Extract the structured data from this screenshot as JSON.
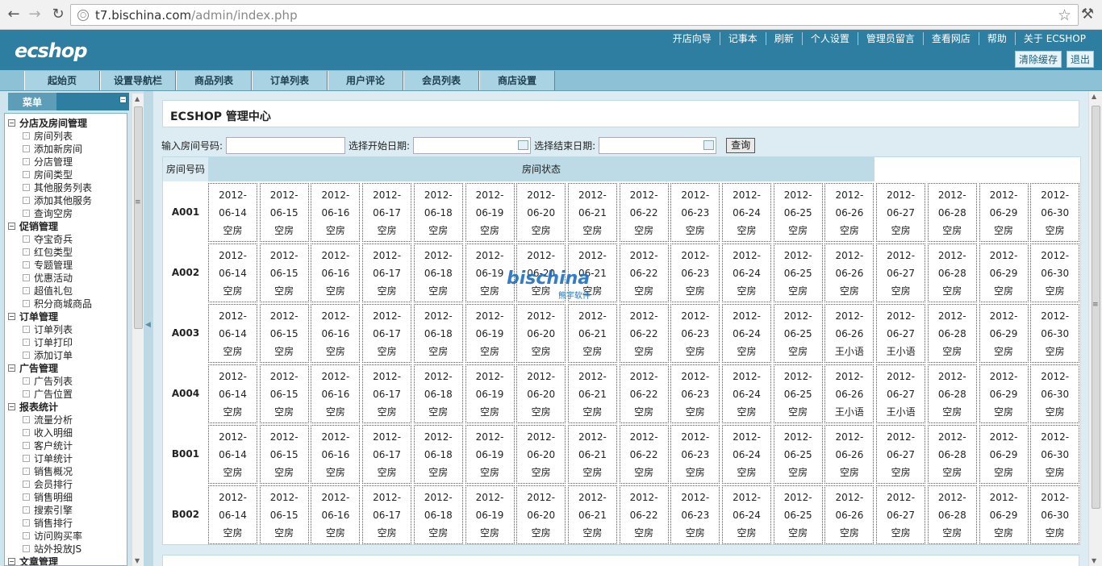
{
  "browser": {
    "url_host": "t7.bischina.com",
    "url_path": "/admin/index.php"
  },
  "header": {
    "logo": "ECSHOP",
    "links": [
      "开店向导",
      "记事本",
      "刷新",
      "个人设置",
      "管理员留言",
      "查看网店",
      "帮助",
      "关于 ECSHOP"
    ],
    "clear_cache": "清除缓存",
    "logout": "退出"
  },
  "tabs": [
    "起始页",
    "设置导航栏",
    "商品列表",
    "订单列表",
    "用户评论",
    "会员列表",
    "商店设置"
  ],
  "sidebar": {
    "title": "菜单",
    "groups": [
      {
        "label": "分店及房间管理",
        "items": [
          "房间列表",
          "添加新房间",
          "分店管理",
          "房间类型",
          "其他服务列表",
          "添加其他服务",
          "查询空房"
        ]
      },
      {
        "label": "促销管理",
        "items": [
          "夺宝奇兵",
          "红包类型",
          "专题管理",
          "优惠活动",
          "超值礼包",
          "积分商城商品"
        ]
      },
      {
        "label": "订单管理",
        "items": [
          "订单列表",
          "订单打印",
          "添加订单"
        ]
      },
      {
        "label": "广告管理",
        "items": [
          "广告列表",
          "广告位置"
        ]
      },
      {
        "label": "报表统计",
        "items": [
          "流量分析",
          "收入明细",
          "客户统计",
          "订单统计",
          "销售概况",
          "会员排行",
          "销售明细",
          "搜索引擎",
          "销售排行",
          "访问购买率",
          "站外投放JS"
        ]
      },
      {
        "label": "文章管理",
        "items": []
      }
    ]
  },
  "main": {
    "title": "ECSHOP 管理中心",
    "search": {
      "room_label": "输入房间号码:",
      "start_label": "选择开始日期:",
      "end_label": "选择结束日期:",
      "query_button": "查询"
    },
    "table": {
      "col_code": "房间号码",
      "col_status": "房间状态",
      "year": "2012-",
      "dates": [
        "06-14",
        "06-15",
        "06-16",
        "06-17",
        "06-18",
        "06-19",
        "06-20",
        "06-21",
        "06-22",
        "06-23",
        "06-24",
        "06-25",
        "06-26",
        "06-27",
        "06-28",
        "06-29",
        "06-30"
      ],
      "rows": [
        {
          "code": "A001",
          "status": [
            "空房",
            "空房",
            "空房",
            "空房",
            "空房",
            "空房",
            "空房",
            "空房",
            "空房",
            "空房",
            "空房",
            "空房",
            "空房",
            "空房",
            "空房",
            "空房",
            "空房"
          ]
        },
        {
          "code": "A002",
          "status": [
            "空房",
            "空房",
            "空房",
            "空房",
            "空房",
            "空房",
            "空房",
            "空房",
            "空房",
            "空房",
            "空房",
            "空房",
            "空房",
            "空房",
            "空房",
            "空房",
            "空房"
          ]
        },
        {
          "code": "A003",
          "status": [
            "空房",
            "空房",
            "空房",
            "空房",
            "空房",
            "空房",
            "空房",
            "空房",
            "空房",
            "空房",
            "空房",
            "空房",
            "王小语",
            "王小语",
            "空房",
            "空房",
            "空房"
          ]
        },
        {
          "code": "A004",
          "status": [
            "空房",
            "空房",
            "空房",
            "空房",
            "空房",
            "空房",
            "空房",
            "空房",
            "空房",
            "空房",
            "空房",
            "空房",
            "王小语",
            "王小语",
            "空房",
            "空房",
            "空房"
          ]
        },
        {
          "code": "B001",
          "status": [
            "空房",
            "空房",
            "空房",
            "空房",
            "空房",
            "空房",
            "空房",
            "空房",
            "空房",
            "空房",
            "空房",
            "空房",
            "空房",
            "空房",
            "空房",
            "空房",
            "空房"
          ]
        },
        {
          "code": "B002",
          "status": [
            "空房",
            "空房",
            "空房",
            "空房",
            "空房",
            "空房",
            "空房",
            "空房",
            "空房",
            "空房",
            "空房",
            "空房",
            "空房",
            "空房",
            "空房",
            "空房",
            "空房"
          ]
        }
      ]
    }
  },
  "watermark": {
    "brand": "bischina",
    "sub": "熊宇软件"
  },
  "colors": {
    "header": "#2e7ea1",
    "tabbar": "#8dc2d6",
    "sidebar": "#cfe5ee",
    "main_bg": "#dcecf2"
  }
}
